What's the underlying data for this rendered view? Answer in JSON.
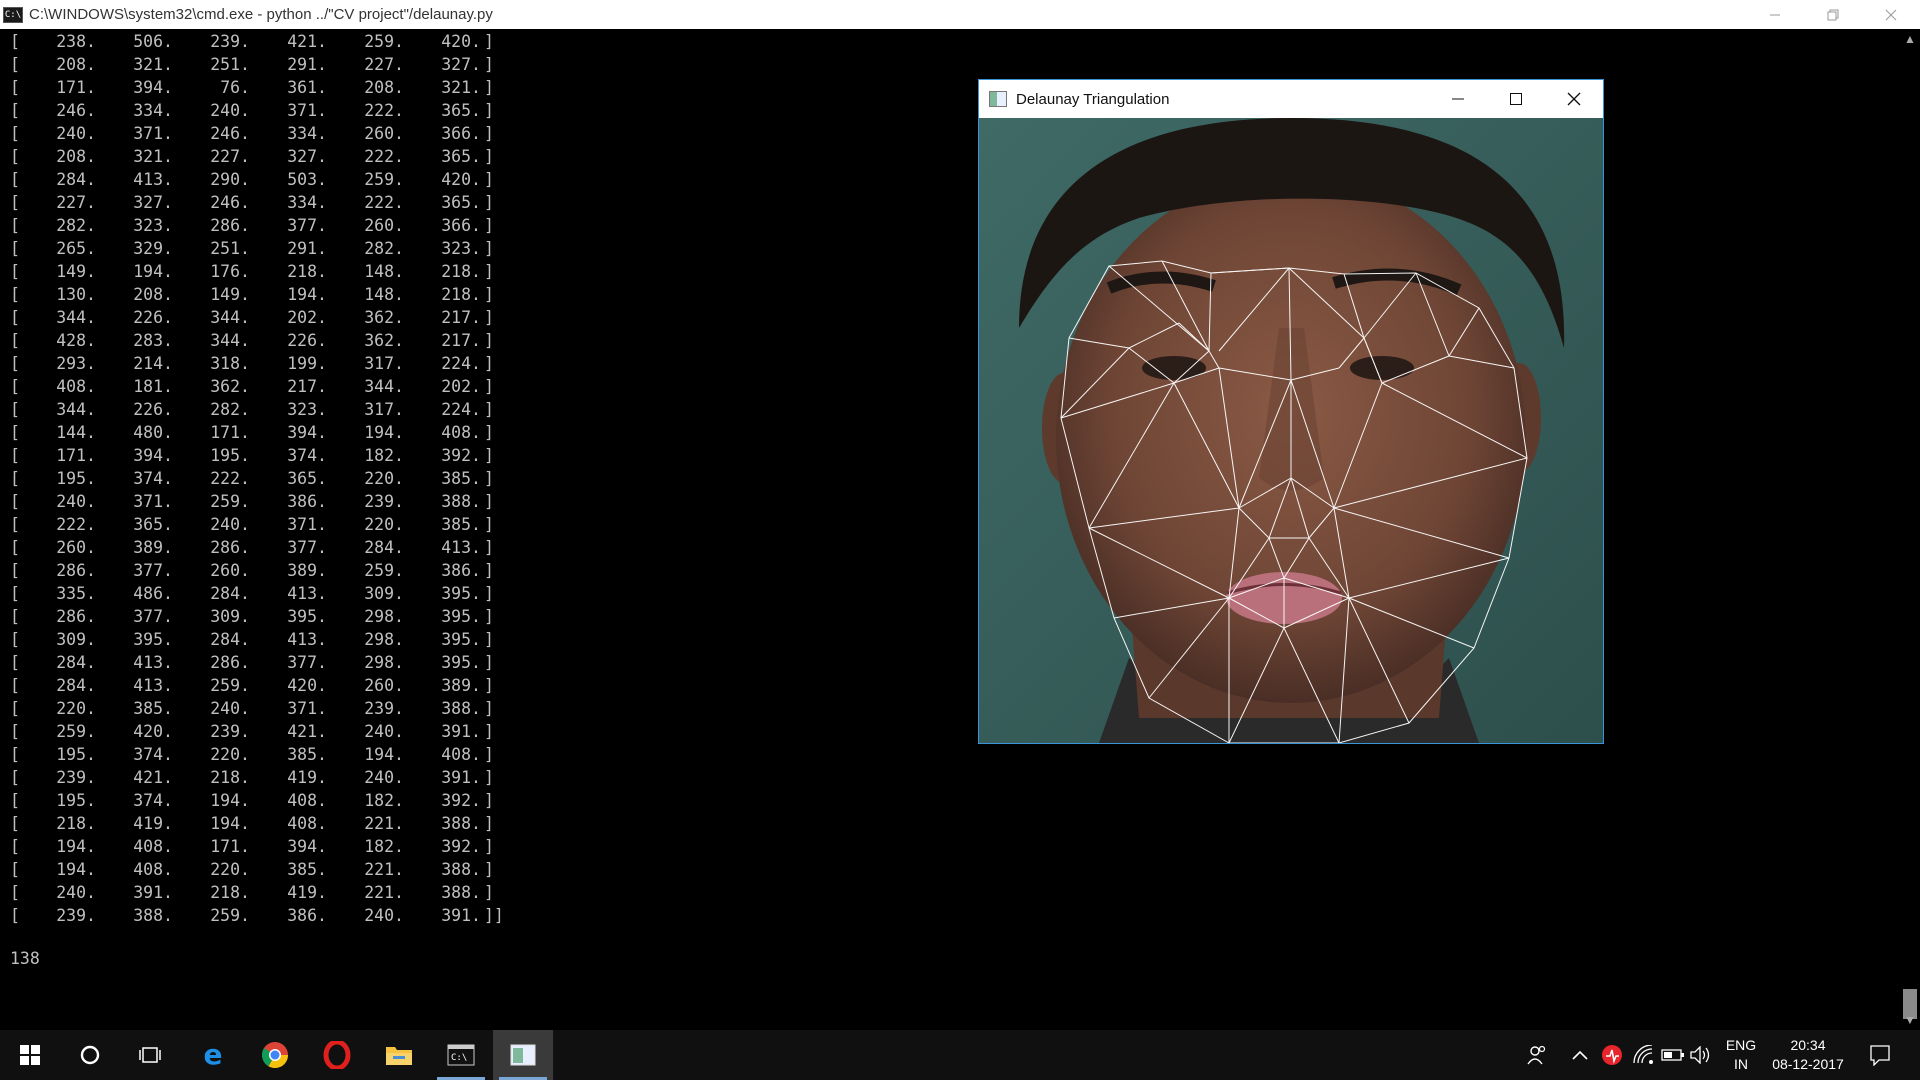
{
  "console_window": {
    "title": "C:\\WINDOWS\\system32\\cmd.exe - python  ../\"CV project\"/delaunay.py",
    "controls": [
      "minimize",
      "restore",
      "close"
    ]
  },
  "console_output": {
    "rows": [
      [
        "238.",
        "506.",
        "239.",
        "421.",
        "259.",
        "420."
      ],
      [
        "208.",
        "321.",
        "251.",
        "291.",
        "227.",
        "327."
      ],
      [
        "171.",
        "394.",
        "76.",
        "361.",
        "208.",
        "321."
      ],
      [
        "246.",
        "334.",
        "240.",
        "371.",
        "222.",
        "365."
      ],
      [
        "240.",
        "371.",
        "246.",
        "334.",
        "260.",
        "366."
      ],
      [
        "208.",
        "321.",
        "227.",
        "327.",
        "222.",
        "365."
      ],
      [
        "284.",
        "413.",
        "290.",
        "503.",
        "259.",
        "420."
      ],
      [
        "227.",
        "327.",
        "246.",
        "334.",
        "222.",
        "365."
      ],
      [
        "282.",
        "323.",
        "286.",
        "377.",
        "260.",
        "366."
      ],
      [
        "265.",
        "329.",
        "251.",
        "291.",
        "282.",
        "323."
      ],
      [
        "149.",
        "194.",
        "176.",
        "218.",
        "148.",
        "218."
      ],
      [
        "130.",
        "208.",
        "149.",
        "194.",
        "148.",
        "218."
      ],
      [
        "344.",
        "226.",
        "344.",
        "202.",
        "362.",
        "217."
      ],
      [
        "428.",
        "283.",
        "344.",
        "226.",
        "362.",
        "217."
      ],
      [
        "293.",
        "214.",
        "318.",
        "199.",
        "317.",
        "224."
      ],
      [
        "408.",
        "181.",
        "362.",
        "217.",
        "344.",
        "202."
      ],
      [
        "344.",
        "226.",
        "282.",
        "323.",
        "317.",
        "224."
      ],
      [
        "144.",
        "480.",
        "171.",
        "394.",
        "194.",
        "408."
      ],
      [
        "171.",
        "394.",
        "195.",
        "374.",
        "182.",
        "392."
      ],
      [
        "195.",
        "374.",
        "222.",
        "365.",
        "220.",
        "385."
      ],
      [
        "240.",
        "371.",
        "259.",
        "386.",
        "239.",
        "388."
      ],
      [
        "222.",
        "365.",
        "240.",
        "371.",
        "220.",
        "385."
      ],
      [
        "260.",
        "389.",
        "286.",
        "377.",
        "284.",
        "413."
      ],
      [
        "286.",
        "377.",
        "260.",
        "389.",
        "259.",
        "386."
      ],
      [
        "335.",
        "486.",
        "284.",
        "413.",
        "309.",
        "395."
      ],
      [
        "286.",
        "377.",
        "309.",
        "395.",
        "298.",
        "395."
      ],
      [
        "309.",
        "395.",
        "284.",
        "413.",
        "298.",
        "395."
      ],
      [
        "284.",
        "413.",
        "286.",
        "377.",
        "298.",
        "395."
      ],
      [
        "284.",
        "413.",
        "259.",
        "420.",
        "260.",
        "389."
      ],
      [
        "220.",
        "385.",
        "240.",
        "371.",
        "239.",
        "388."
      ],
      [
        "259.",
        "420.",
        "239.",
        "421.",
        "240.",
        "391."
      ],
      [
        "195.",
        "374.",
        "220.",
        "385.",
        "194.",
        "408."
      ],
      [
        "239.",
        "421.",
        "218.",
        "419.",
        "240.",
        "391."
      ],
      [
        "195.",
        "374.",
        "194.",
        "408.",
        "182.",
        "392."
      ],
      [
        "218.",
        "419.",
        "194.",
        "408.",
        "221.",
        "388."
      ],
      [
        "194.",
        "408.",
        "171.",
        "394.",
        "182.",
        "392."
      ],
      [
        "194.",
        "408.",
        "220.",
        "385.",
        "221.",
        "388."
      ],
      [
        "240.",
        "391.",
        "218.",
        "419.",
        "221.",
        "388."
      ],
      [
        "239.",
        "388.",
        "259.",
        "386.",
        "240.",
        "391."
      ]
    ],
    "triangle_count": "138"
  },
  "cv_window": {
    "title": "Delaunay Triangulation",
    "controls": [
      "minimize",
      "maximize",
      "close"
    ],
    "image_description_icon": "face-mesh-image"
  },
  "taskbar": {
    "pinned": [
      {
        "name": "start-button",
        "icon": "windows-logo-icon"
      },
      {
        "name": "cortana-button",
        "icon": "circle-icon"
      },
      {
        "name": "task-view-button",
        "icon": "task-view-icon"
      },
      {
        "name": "edge-button",
        "icon": "edge-icon"
      },
      {
        "name": "chrome-button",
        "icon": "chrome-icon"
      },
      {
        "name": "opera-button",
        "icon": "opera-icon"
      },
      {
        "name": "file-explorer-button",
        "icon": "folder-icon"
      },
      {
        "name": "cmd-button",
        "icon": "terminal-icon",
        "running": true
      },
      {
        "name": "cv-window-button",
        "icon": "image-window-icon",
        "running": true,
        "active": true
      }
    ],
    "language_primary": "ENG",
    "language_secondary": "IN",
    "time": "20:34",
    "date": "08-12-2017",
    "colors": {
      "accent": "#7aa7d6",
      "opera_red": "#e0201d",
      "edge_blue": "#1e8fe6",
      "folder_yellow": "#f5c242"
    }
  }
}
